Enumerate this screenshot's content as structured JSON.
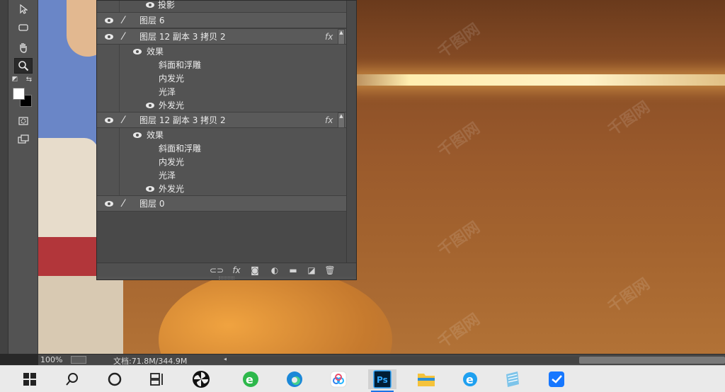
{
  "app": "Adobe Photoshop",
  "layers_panel": {
    "rows": [
      {
        "kind": "effect",
        "label": "投影",
        "visible": true
      },
      {
        "kind": "layer",
        "label": "图层 6",
        "visible": true,
        "has_fx": false
      },
      {
        "kind": "layer",
        "label": "图层 12 副本 3 拷贝 2",
        "visible": true,
        "has_fx": true,
        "fx_label": "fx"
      },
      {
        "kind": "effects-group",
        "label": "效果",
        "visible": true
      },
      {
        "kind": "effect",
        "label": "斜面和浮雕",
        "visible": false
      },
      {
        "kind": "effect",
        "label": "内发光",
        "visible": false
      },
      {
        "kind": "effect",
        "label": "光泽",
        "visible": false
      },
      {
        "kind": "effect",
        "label": "外发光",
        "visible": true
      },
      {
        "kind": "layer",
        "label": "图层 12 副本 3 拷贝 2",
        "visible": true,
        "has_fx": true,
        "fx_label": "fx"
      },
      {
        "kind": "effects-group",
        "label": "效果",
        "visible": true
      },
      {
        "kind": "effect",
        "label": "斜面和浮雕",
        "visible": false
      },
      {
        "kind": "effect",
        "label": "内发光",
        "visible": false
      },
      {
        "kind": "effect",
        "label": "光泽",
        "visible": false
      },
      {
        "kind": "effect",
        "label": "外发光",
        "visible": true
      },
      {
        "kind": "layer",
        "label": "图层 0",
        "visible": true,
        "has_fx": false
      }
    ],
    "footer_icons": [
      "link-icon",
      "fx-icon",
      "mask-icon",
      "adjustment-icon",
      "folder-icon",
      "new-layer-icon",
      "trash-icon"
    ]
  },
  "toolbar": {
    "tools": [
      "move-tool-icon",
      "shape-tool-icon",
      "hand-tool-icon",
      "zoom-tool-icon",
      "quick-mask-icon",
      "screen-mode-icon"
    ],
    "foreground_color": "#ffffff",
    "background_color": "#000000"
  },
  "status": {
    "zoom": "100%",
    "doc": "文档:71.8M/344.9M"
  },
  "taskbar": {
    "items": [
      "windows-start-icon",
      "search-icon",
      "cortana-icon",
      "task-view-icon",
      "pinwheel-app-icon",
      "360-browser-icon",
      "edge-icon",
      "baidu-netdisk-icon",
      "photoshop-icon",
      "file-explorer-icon",
      "ie-icon",
      "notepad-icon",
      "feishu-icon"
    ],
    "ps_label": "Ps",
    "active": "photoshop-icon"
  },
  "watermark": "千图网"
}
